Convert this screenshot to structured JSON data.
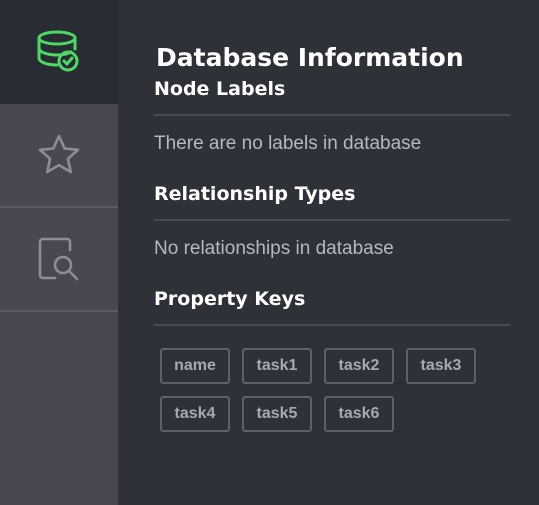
{
  "sidebar": {
    "items": [
      {
        "icon": "database-check-icon",
        "active": true,
        "color": "#4cd964"
      },
      {
        "icon": "star-icon",
        "active": false
      },
      {
        "icon": "document-search-icon",
        "active": false
      }
    ]
  },
  "panel": {
    "title": "Database Information",
    "node_labels": {
      "heading": "Node Labels",
      "empty_text": "There are no labels in database"
    },
    "relationship_types": {
      "heading": "Relationship Types",
      "empty_text": "No relationships in database"
    },
    "property_keys": {
      "heading": "Property Keys",
      "keys": [
        "name",
        "task1",
        "task2",
        "task3",
        "task4",
        "task5",
        "task6"
      ]
    }
  }
}
